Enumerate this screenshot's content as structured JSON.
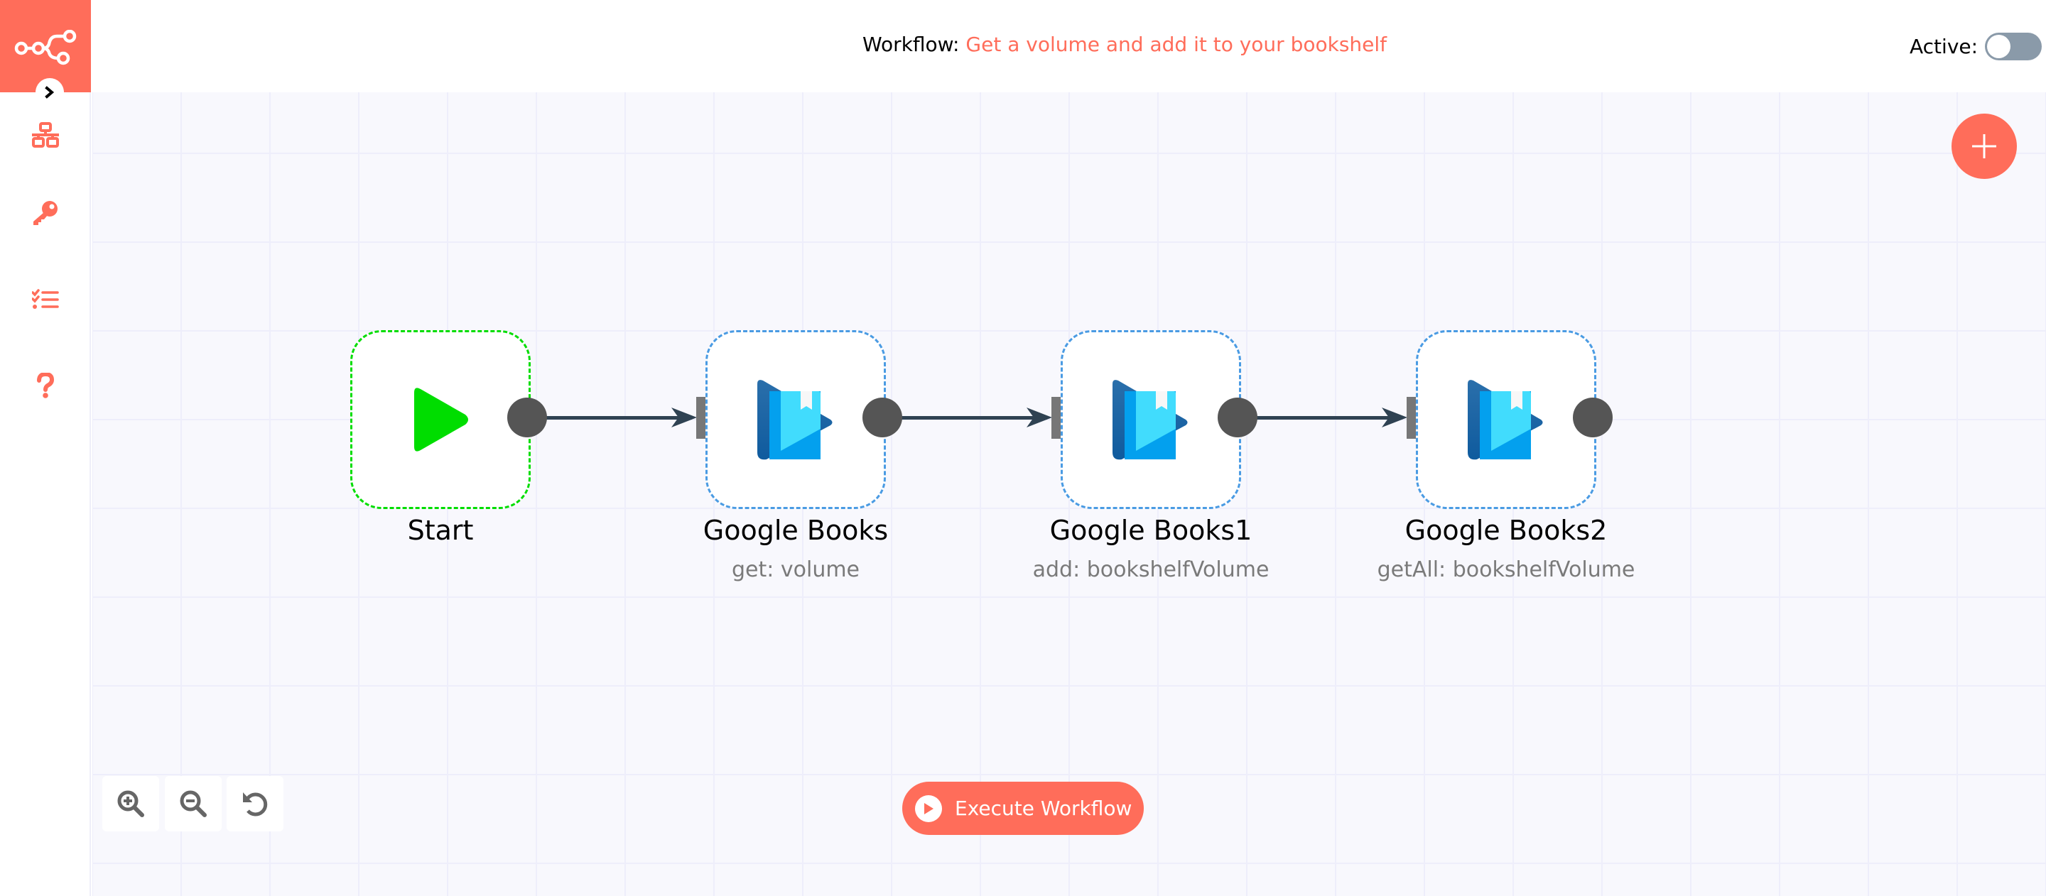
{
  "header": {
    "workflow_prefix": "Workflow:",
    "workflow_name": "Get a volume and add it to your bookshelf",
    "active_label": "Active:",
    "active": false
  },
  "sidebar": {
    "items": [
      {
        "name": "workflows",
        "icon": "network-icon"
      },
      {
        "name": "credentials",
        "icon": "key-icon"
      },
      {
        "name": "executions",
        "icon": "tasks-icon"
      },
      {
        "name": "help",
        "icon": "question-icon"
      }
    ]
  },
  "nodes": [
    {
      "label": "Start",
      "subtitle": "",
      "icon": "play-icon"
    },
    {
      "label": "Google Books",
      "subtitle": "get: volume",
      "icon": "google-books-icon"
    },
    {
      "label": "Google Books1",
      "subtitle": "add: bookshelfVolume",
      "icon": "google-books-icon"
    },
    {
      "label": "Google Books2",
      "subtitle": "getAll: bookshelfVolume",
      "icon": "google-books-icon"
    }
  ],
  "connections": [
    {
      "from": "Start",
      "to": "Google Books"
    },
    {
      "from": "Google Books",
      "to": "Google Books1"
    },
    {
      "from": "Google Books1",
      "to": "Google Books2"
    }
  ],
  "controls": {
    "execute_label": "Execute Workflow",
    "zoom_in": "zoom-in-icon",
    "zoom_out": "zoom-out-icon",
    "reset": "reset-zoom-icon",
    "add_node": "plus-icon"
  },
  "colors": {
    "brand": "#ff6d5a",
    "start_border": "#00dd00",
    "node_border": "#4a9be3",
    "connection": "#2f4252"
  }
}
